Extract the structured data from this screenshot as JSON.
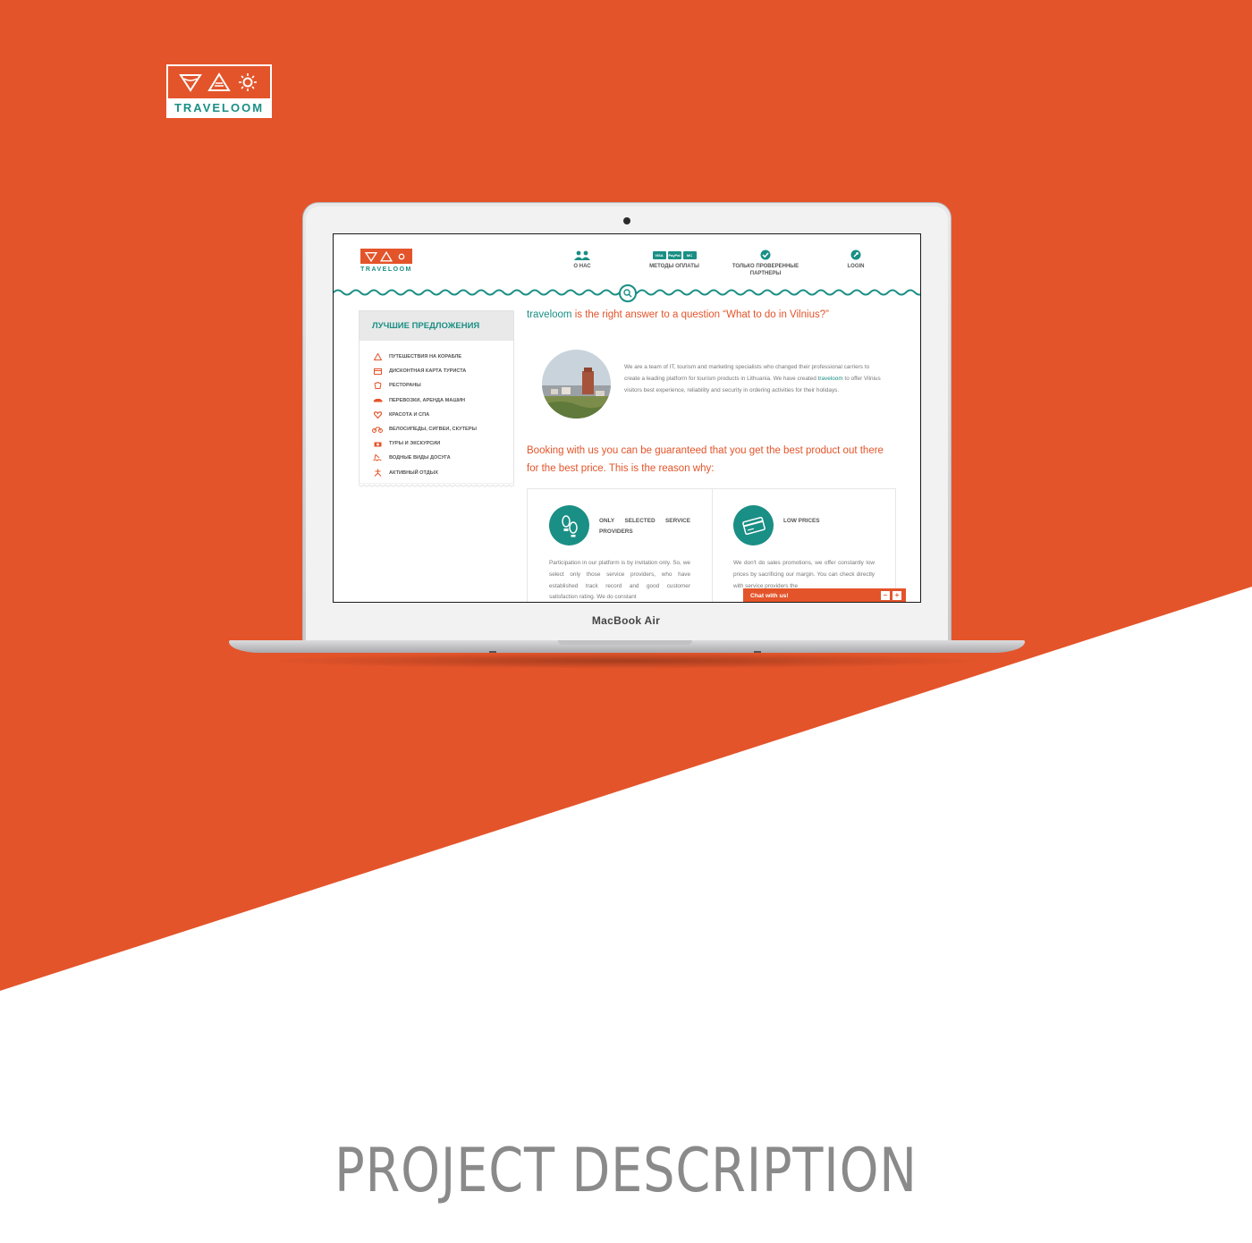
{
  "colors": {
    "orange": "#e4542a",
    "teal": "#1a8f85",
    "gray_text": "#8a8a8a"
  },
  "brand": {
    "wordmark": "TRAVELOOM"
  },
  "laptop": {
    "label": "MacBook Air"
  },
  "site": {
    "logo_wordmark": "TRAVELOOM",
    "nav": [
      {
        "icon": "users-icon",
        "label": "О НАС"
      },
      {
        "icon": "payment-cards-icon",
        "label": "МЕТОДЫ ОПЛАТЫ",
        "badges": [
          "VISA",
          "PayPal",
          "MC"
        ]
      },
      {
        "icon": "checkmark-icon",
        "label_line1": "ТОЛЬКО ПРОВЕРЕННЫЕ",
        "label_line2": "ПАРТНЕРЫ"
      },
      {
        "icon": "key-icon",
        "label": "LOGIN"
      }
    ],
    "sidebar": {
      "title": "ЛУЧШИЕ ПРЕДЛОЖЕНИЯ",
      "items": [
        {
          "icon": "boat-icon",
          "label": "ПУТЕШЕСТВИЯ НА КОРАБЛЕ"
        },
        {
          "icon": "card-icon",
          "label": "ДИСКОНТНАЯ КАРТА ТУРИСТА"
        },
        {
          "icon": "chef-hat-icon",
          "label": "РЕСТОРАНЫ"
        },
        {
          "icon": "car-icon",
          "label": "ПЕРЕВОЗКИ, АРЕНДА МАШИН"
        },
        {
          "icon": "heart-icon",
          "label": "КРАСОТА И СПА"
        },
        {
          "icon": "bicycle-icon",
          "label": "ВЕЛОСИПЕДЫ, СИГВЕИ, СКУТЕРЫ"
        },
        {
          "icon": "camera-icon",
          "label": "ТУРЫ И ЭКСКУРСИИ"
        },
        {
          "icon": "water-icon",
          "label": "ВОДНЫЕ ВИДЫ ДОСУГА"
        },
        {
          "icon": "activity-icon",
          "label": "АКТИВНЫЙ ОТДЫХ"
        }
      ]
    },
    "headline_brand": "traveloom",
    "headline_rest": " is the right answer to a question “What to do in Vilnius?”",
    "about_part1": "We are a team of IT, tourism and marketing specialists who changed their professional carriers to create a leading platform for tourism products in Lithuania. We have created ",
    "about_brand": "traveloom",
    "about_part2": " to offer Vilnius visitors best experience, reliability and security in ordering activities for their holidays.",
    "booking_title": "Booking with us you can be guaranteed that you get the best product out there for the best price. This is the reason why:",
    "features": [
      {
        "icon": "footprints-icon",
        "title": "ONLY SELECTED SERVICE PROVIDERS",
        "body": "Participation in our platform is by invitation only. So, we select only those service providers, who have established track record and good customer satisfaction rating. We do constant"
      },
      {
        "icon": "credit-card-icon",
        "title": "LOW PRICES",
        "body": "We don't do sales promotions, we offer constantly low prices by sacrificing our margin. You can check directly with service providers the"
      }
    ],
    "chat": {
      "label": "Chat with us!",
      "minimize": "–",
      "expand": "+"
    }
  },
  "project_title": "PROJECT DESCRIPTION"
}
